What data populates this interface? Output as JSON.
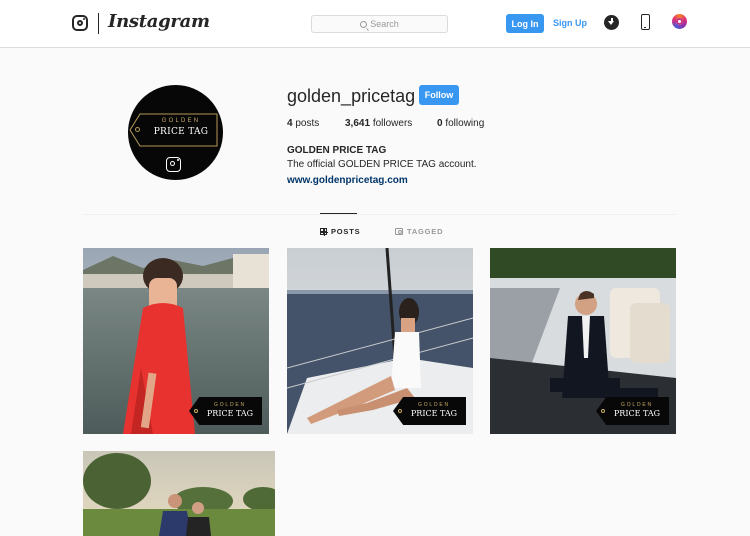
{
  "header": {
    "brand": "Instagram",
    "search_placeholder": "Search",
    "login_label": "Log In",
    "signup_label": "Sign Up",
    "icons": [
      "instagram-logo-icon",
      "download-icon",
      "mobile-phone-icon",
      "instagram-app-icon",
      "search-icon"
    ]
  },
  "profile": {
    "username": "golden_pricetag",
    "follow_label": "Follow",
    "posts_count": "4",
    "posts_label": "posts",
    "followers_count": "3,641",
    "followers_label": "followers",
    "following_count": "0",
    "following_label": "following",
    "full_name": "GOLDEN PRICE TAG",
    "bio": "The official GOLDEN PRICE TAG account.",
    "website": "www.goldenpricetag.com",
    "avatar_logo": {
      "top": "GOLDEN",
      "main": "PRICE TAG"
    }
  },
  "tabs": [
    {
      "label": "POSTS",
      "active": true
    },
    {
      "label": "TAGGED",
      "active": false
    }
  ],
  "posts": [
    {
      "watermark_top": "GOLDEN",
      "watermark_main": "PRICE TAG"
    },
    {
      "watermark_top": "GOLDEN",
      "watermark_main": "PRICE TAG"
    },
    {
      "watermark_top": "GOLDEN",
      "watermark_main": "PRICE TAG"
    },
    {
      "watermark_top": "",
      "watermark_main": ""
    }
  ],
  "colors": {
    "accent": "#3897f0",
    "link": "#003569",
    "gold": "#c7ab63",
    "border": "#dbdbdb",
    "background": "#fafafa"
  }
}
